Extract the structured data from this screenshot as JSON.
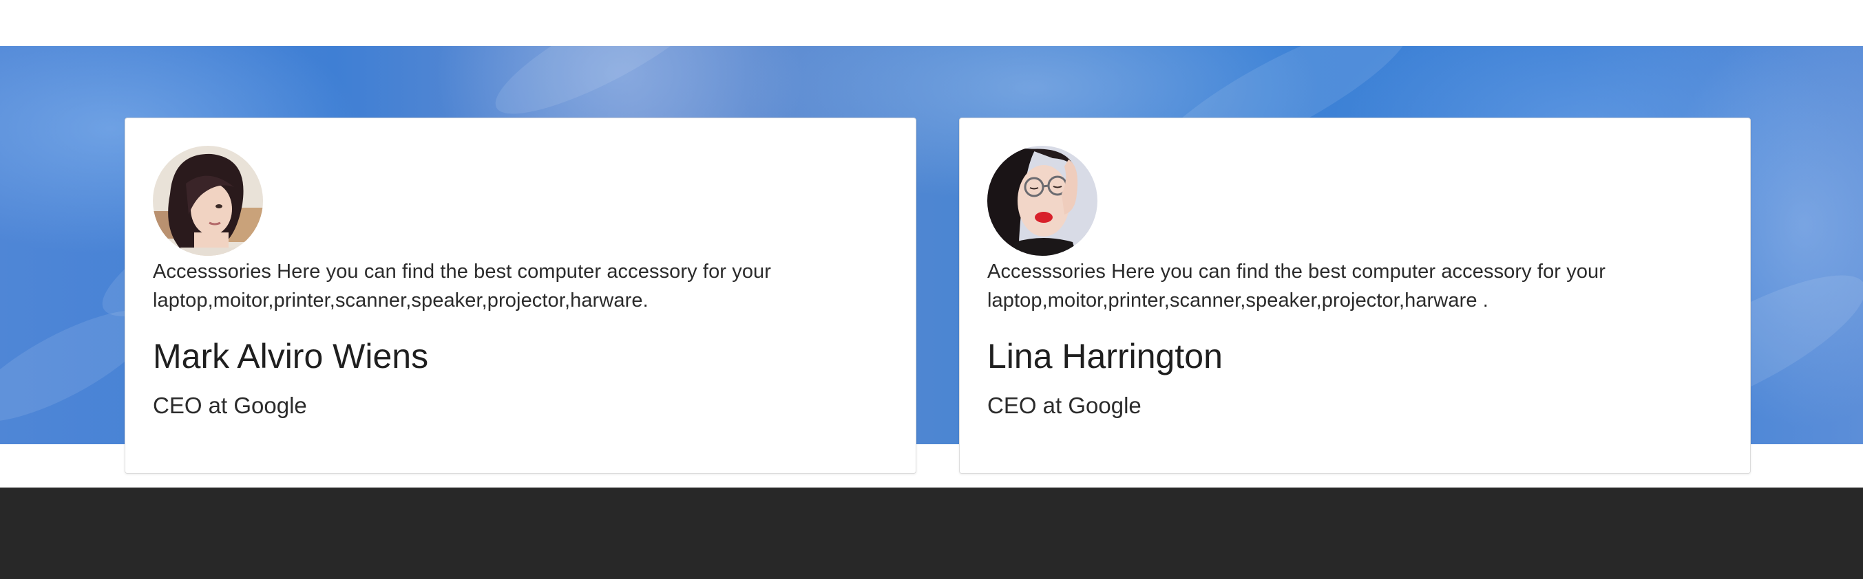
{
  "testimonials": [
    {
      "quote": "Accesssories Here you can find the best computer accessory for your laptop,moitor,printer,scanner,speaker,projector,harware.",
      "name": "Mark Alviro Wiens",
      "role": "CEO at Google",
      "avatar": "woman-dark-hair-portrait"
    },
    {
      "quote": "Accesssories Here you can find the best computer accessory for your laptop,moitor,printer,scanner,speaker,projector,harware .",
      "name": "Lina Harrington",
      "role": "CEO at Google",
      "avatar": "woman-glasses-portrait"
    }
  ],
  "colors": {
    "hero_band": "#3f7fd4",
    "card_bg": "#ffffff",
    "footer_bg": "#282828",
    "text": "#2b2b2b"
  }
}
